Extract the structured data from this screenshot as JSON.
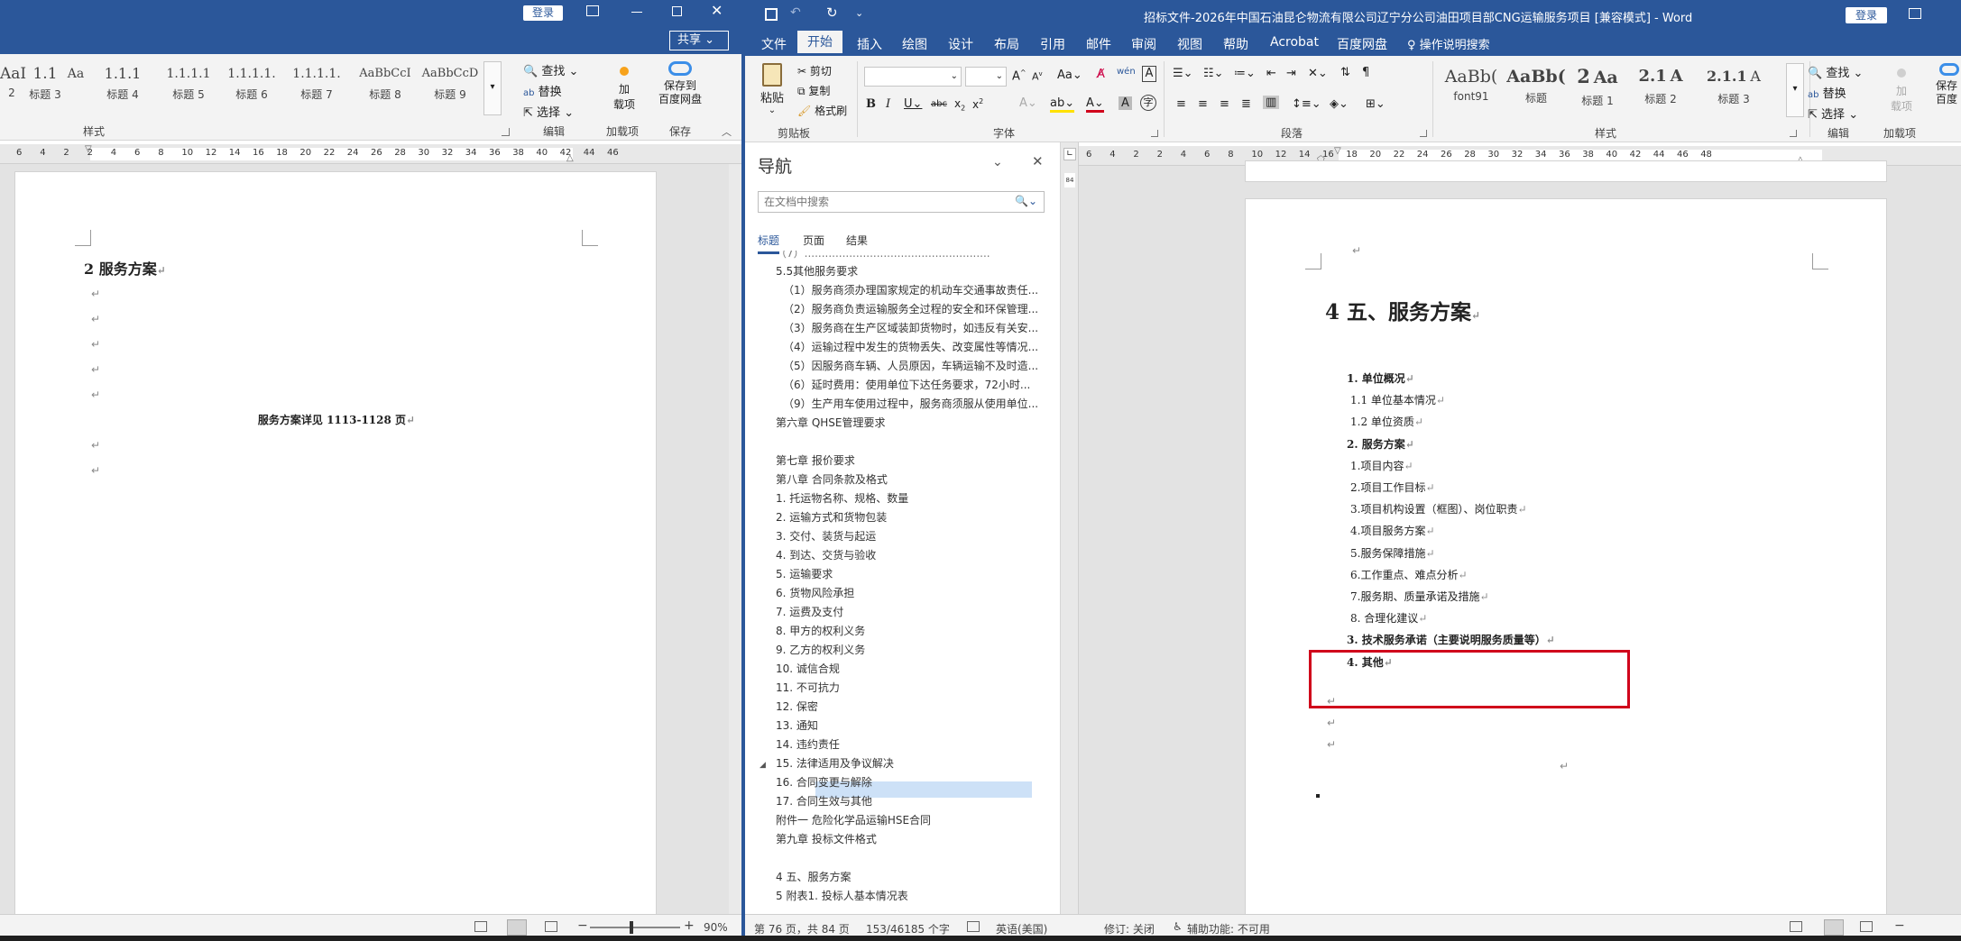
{
  "left": {
    "login": "登录",
    "share": "共享",
    "styles": [
      "AaI",
      "1.1",
      "Aa",
      "1.1.1",
      "1.1.1.1",
      "1.1.1.1.",
      "1.1.1.1.",
      "AaBbCcI",
      "AaBbCcD"
    ],
    "style_names": [
      "2",
      "标题 3",
      "",
      "标题 4",
      "标题 5",
      "标题 6",
      "标题 7",
      "标题 8",
      "标题 9"
    ],
    "group_styles": "样式",
    "find": "查找",
    "replace": "替换",
    "select": "选择",
    "group_edit": "编辑",
    "addon_label": "加\n载项",
    "group_addon": "加载项",
    "save_baidu": "保存到\n百度网盘",
    "group_save": "保存",
    "ruler": [
      "6",
      "4",
      "2",
      "2",
      "4",
      "6",
      "8",
      "10",
      "12",
      "14",
      "16",
      "18",
      "20",
      "22",
      "24",
      "26",
      "28",
      "30",
      "32",
      "34",
      "36",
      "38",
      "40",
      "42",
      "44",
      "46"
    ],
    "heading": "2   服务方案",
    "detail": "服务方案详见 1113-1128 页",
    "zoom": "90%"
  },
  "right": {
    "title": "招标文件-2026年中国石油昆仑物流有限公司辽宁分公司油田项目部CNG运输服务项目 [兼容模式] - Word",
    "login": "登录",
    "tabs": [
      "文件",
      "开始",
      "插入",
      "绘图",
      "设计",
      "布局",
      "引用",
      "邮件",
      "审阅",
      "视图",
      "帮助",
      "Acrobat",
      "百度网盘"
    ],
    "tell_me": "操作说明搜索",
    "paste": "粘贴",
    "cut": "剪切",
    "copy": "复制",
    "format_painter": "格式刷",
    "group_clipboard": "剪贴板",
    "group_font": "字体",
    "group_paragraph": "段落",
    "group_styles": "样式",
    "styles": [
      "AaBb(",
      "AaBb(",
      "2",
      "Aa",
      "2.1",
      "A",
      "2.1.1",
      "A"
    ],
    "style_names": [
      "font91",
      "标题",
      "标题 1",
      "标题 2",
      "标题 3"
    ],
    "find": "查找",
    "replace": "替换",
    "select": "选择",
    "group_edit": "编辑",
    "addon_label": "加\n载项",
    "group_addon": "加载项",
    "save_baidu": "保存\n百度",
    "ruler": [
      "6",
      "4",
      "2",
      "2",
      "4",
      "6",
      "8",
      "10",
      "12",
      "14",
      "16",
      "18",
      "20",
      "22",
      "24",
      "26",
      "28",
      "30",
      "32",
      "34",
      "36",
      "38",
      "40",
      "42",
      "44",
      "46",
      "48"
    ],
    "doc_heading": "4  五、服务方案",
    "doc_lines": [
      {
        "text": "1.  单位概况",
        "bold": true
      },
      {
        "text": "1.1 单位基本情况",
        "bold": false
      },
      {
        "text": "1.2 单位资质",
        "bold": false
      },
      {
        "text": "2.  服务方案",
        "bold": true
      },
      {
        "text": "1.项目内容",
        "bold": false
      },
      {
        "text": "2.项目工作目标",
        "bold": false
      },
      {
        "text": "3.项目机构设置（框图）、岗位职责",
        "bold": false
      },
      {
        "text": "4.项目服务方案",
        "bold": false
      },
      {
        "text": "5.服务保障措施",
        "bold": false
      },
      {
        "text": "6.工作重点、难点分析",
        "bold": false
      },
      {
        "text": "7.服务期、质量承诺及措施",
        "bold": false
      },
      {
        "text": "8. 合理化建议",
        "bold": false
      },
      {
        "text": "3.  技术服务承诺（主要说明服务质量等）",
        "bold": true
      },
      {
        "text": "4.  其他",
        "bold": true
      }
    ],
    "status_page": "第 76 页，共 84 页",
    "status_words": "153/46185 个字",
    "status_lang": "英语(美国)",
    "status_track": "修订: 关闭",
    "status_access": "辅助功能: 不可用"
  },
  "nav": {
    "title": "导航",
    "search_placeholder": "在文档中搜索",
    "tabs": [
      "标题",
      "页面",
      "结果"
    ],
    "items": [
      {
        "text": "5.5其他服务要求",
        "level": 1
      },
      {
        "text": "（1）服务商须办理国家规定的机动车交通事故责任...",
        "level": 2
      },
      {
        "text": "（2）服务商负责运输服务全过程的安全和环保管理...",
        "level": 2
      },
      {
        "text": "（3）服务商在生产区域装卸货物时，如违反有关安...",
        "level": 2
      },
      {
        "text": "（4）运输过程中发生的货物丢失、改变属性等情况...",
        "level": 2
      },
      {
        "text": "（5）因服务商车辆、人员原因，车辆运输不及时造...",
        "level": 2
      },
      {
        "text": "（6）延时费用：使用单位下达任务要求，72小时...",
        "level": 2
      },
      {
        "text": "（9）生产用车使用过程中，服务商须服从使用单位...",
        "level": 2
      },
      {
        "text": "第六章  QHSE管理要求",
        "level": 1
      },
      {
        "text": "",
        "level": 1
      },
      {
        "text": "第七章  报价要求",
        "level": 1
      },
      {
        "text": "第八章  合同条款及格式",
        "level": 1
      },
      {
        "text": "1. 托运物名称、规格、数量",
        "level": 1
      },
      {
        "text": "2. 运输方式和货物包装",
        "level": 1
      },
      {
        "text": "3. 交付、装货与起运",
        "level": 1
      },
      {
        "text": "4. 到达、交货与验收",
        "level": 1
      },
      {
        "text": "5. 运输要求",
        "level": 1
      },
      {
        "text": "6. 货物风险承担",
        "level": 1
      },
      {
        "text": "7. 运费及支付",
        "level": 1
      },
      {
        "text": "8. 甲方的权利义务",
        "level": 1
      },
      {
        "text": "9. 乙方的权利义务",
        "level": 1
      },
      {
        "text": "10. 诚信合规",
        "level": 1
      },
      {
        "text": "11. 不可抗力",
        "level": 1
      },
      {
        "text": "12. 保密",
        "level": 1
      },
      {
        "text": "13. 通知",
        "level": 1
      },
      {
        "text": "14. 违约责任",
        "level": 1
      },
      {
        "text": "15. 法律适用及争议解决",
        "level": 1
      },
      {
        "text": "16. 合同变更与解除",
        "level": 1
      },
      {
        "text": "17. 合同生效与其他",
        "level": 1
      },
      {
        "text": "附件一 危险化学品运输HSE合同",
        "level": 1
      },
      {
        "text": "第九章  投标文件格式",
        "level": 1
      },
      {
        "text": "",
        "level": 2
      },
      {
        "text": "4 五、服务方案",
        "level": 1
      },
      {
        "text": "5 附表1. 投标人基本情况表",
        "level": 1
      }
    ]
  },
  "colors": {
    "word_blue": "#2b579a",
    "highlight_red": "#d0021b",
    "nav_selected": "#cde1f7"
  }
}
